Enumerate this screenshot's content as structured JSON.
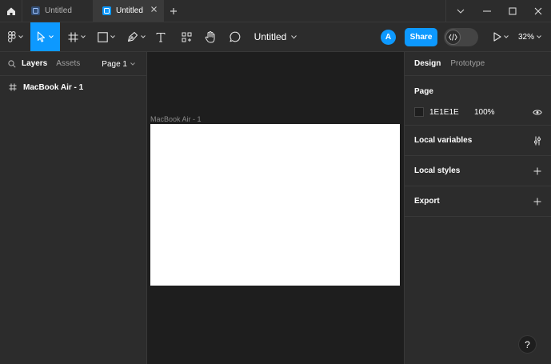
{
  "titlebar": {
    "tabs": [
      {
        "label": "Untitled",
        "active": false
      },
      {
        "label": "Untitled",
        "active": true
      }
    ]
  },
  "toolbar": {
    "document_title": "Untitled",
    "avatar_initial": "A",
    "share_label": "Share",
    "zoom_level": "32%"
  },
  "left_panel": {
    "tabs": [
      "Layers",
      "Assets"
    ],
    "page_selector": "Page 1",
    "layers": [
      {
        "name": "MacBook Air - 1",
        "type": "frame"
      }
    ]
  },
  "canvas": {
    "frame_label": "MacBook Air - 1",
    "frame_fill": "#ffffff",
    "background": "#1e1e1e"
  },
  "right_panel": {
    "tabs": [
      "Design",
      "Prototype"
    ],
    "page_section": {
      "title": "Page",
      "color_hex": "1E1E1E",
      "opacity": "100%"
    },
    "local_variables": "Local variables",
    "local_styles": "Local styles",
    "export": "Export"
  },
  "help": {
    "label": "?"
  },
  "colors": {
    "accent": "#0d99ff",
    "panel_bg": "#2c2c2c",
    "canvas_bg": "#1e1e1e"
  }
}
